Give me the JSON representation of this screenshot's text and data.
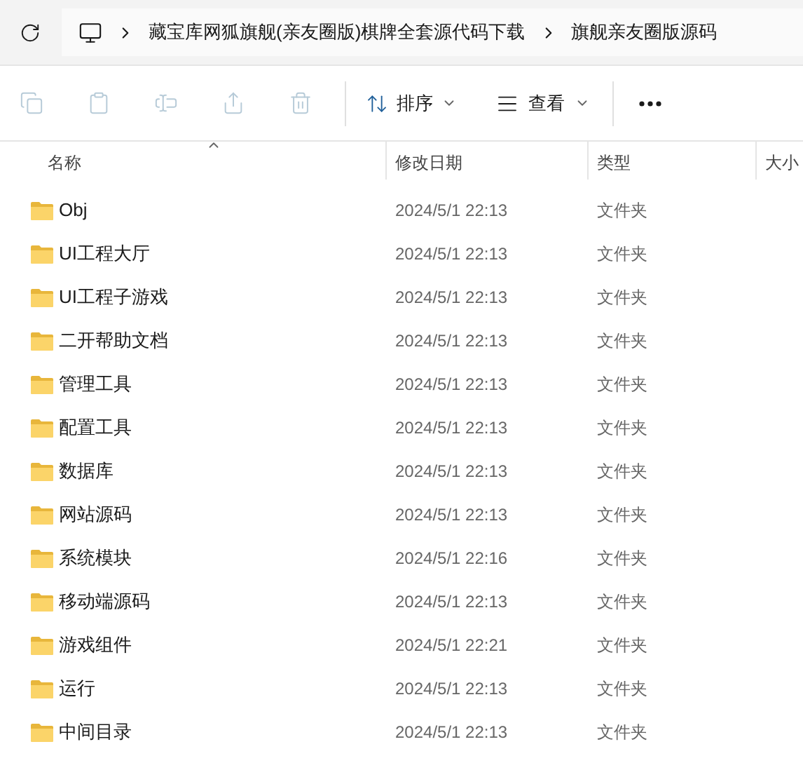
{
  "breadcrumbs": [
    "藏宝库网狐旗舰(亲友圈版)棋牌全套源代码下载",
    "旗舰亲友圈版源码"
  ],
  "toolbar": {
    "actions": [
      {
        "kind": "copy",
        "disabled": true
      },
      {
        "kind": "paste",
        "disabled": true
      },
      {
        "kind": "rename",
        "disabled": true
      },
      {
        "kind": "share",
        "disabled": true
      },
      {
        "kind": "delete",
        "disabled": true
      }
    ],
    "sort": "排序",
    "view": "查看"
  },
  "table": {
    "columns": [
      "名称",
      "修改日期",
      "类型",
      "大小"
    ],
    "rows": [
      {
        "name": "Obj",
        "date": "2024/5/1 22:13",
        "type": "文件夹"
      },
      {
        "name": "UI工程大厅",
        "date": "2024/5/1 22:13",
        "type": "文件夹"
      },
      {
        "name": "UI工程子游戏",
        "date": "2024/5/1 22:13",
        "type": "文件夹"
      },
      {
        "name": "二开帮助文档",
        "date": "2024/5/1 22:13",
        "type": "文件夹"
      },
      {
        "name": "管理工具",
        "date": "2024/5/1 22:13",
        "type": "文件夹"
      },
      {
        "name": "配置工具",
        "date": "2024/5/1 22:13",
        "type": "文件夹"
      },
      {
        "name": "数据库",
        "date": "2024/5/1 22:13",
        "type": "文件夹"
      },
      {
        "name": "网站源码",
        "date": "2024/5/1 22:13",
        "type": "文件夹"
      },
      {
        "name": "系统模块",
        "date": "2024/5/1 22:16",
        "type": "文件夹"
      },
      {
        "name": "移动端源码",
        "date": "2024/5/1 22:13",
        "type": "文件夹"
      },
      {
        "name": "游戏组件",
        "date": "2024/5/1 22:21",
        "type": "文件夹"
      },
      {
        "name": "运行",
        "date": "2024/5/1 22:13",
        "type": "文件夹"
      },
      {
        "name": "中间目录",
        "date": "2024/5/1 22:13",
        "type": "文件夹"
      }
    ]
  }
}
